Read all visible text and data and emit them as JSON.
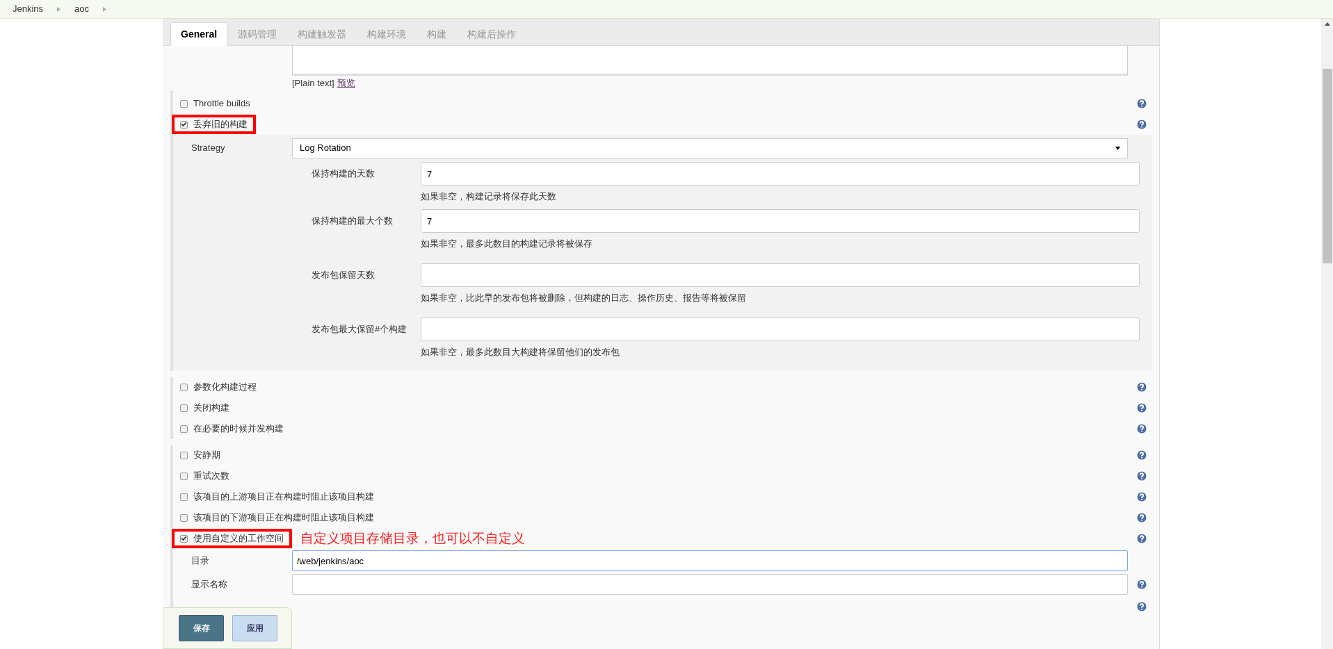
{
  "breadcrumbs": [
    "Jenkins",
    "aoc"
  ],
  "tabs": [
    {
      "label": "General",
      "selected": true
    },
    {
      "label": "源码管理",
      "selected": false
    },
    {
      "label": "构建触发器",
      "selected": false
    },
    {
      "label": "构建环境",
      "selected": false
    },
    {
      "label": "构建",
      "selected": false
    },
    {
      "label": "构建后操作",
      "selected": false
    }
  ],
  "description": {
    "format": "[Plain text]",
    "preview_link": "预览"
  },
  "top_options": [
    {
      "label": "Throttle builds",
      "checked": false,
      "highlighted": false
    },
    {
      "label": "丢弃旧的构建",
      "checked": true,
      "highlighted": true
    }
  ],
  "strategy": {
    "label": "Strategy",
    "value": "Log Rotation",
    "fields": [
      {
        "label": "保持构建的天数",
        "value": "7",
        "hint": "如果非空，构建记录将保存此天数"
      },
      {
        "label": "保持构建的最大个数",
        "value": "7",
        "hint": "如果非空，最多此数目的构建记录将被保存"
      },
      {
        "label": "发布包保留天数",
        "hint": "如果非空，比此早的发布包将被删除，但构建的日志、操作历史、报告等将被保留"
      },
      {
        "label": "发布包最大保留#个构建",
        "hint": "如果非空，最多此数目大构建将保留他们的发布包"
      }
    ]
  },
  "option_groups": [
    [
      {
        "label": "参数化构建过程",
        "checked": false,
        "highlighted": false
      },
      {
        "label": "关闭构建",
        "checked": false,
        "highlighted": false
      },
      {
        "label": "在必要的时候并发构建",
        "checked": false,
        "highlighted": false
      }
    ],
    [
      {
        "label": "安静期",
        "checked": false,
        "highlighted": false
      },
      {
        "label": "重试次数",
        "checked": false,
        "highlighted": false
      },
      {
        "label": "该项目的上游项目正在构建时阻止该项目构建",
        "checked": false,
        "highlighted": false
      },
      {
        "label": "该项目的下游项目正在构建时阻止该项目构建",
        "checked": false,
        "highlighted": false
      },
      {
        "label": "使用自定义的工作空间",
        "checked": true,
        "highlighted": true,
        "annotation": "自定义项目存储目录，也可以不自定义"
      }
    ]
  ],
  "workspace_fields": [
    {
      "label": "目录",
      "value": "/web/jenkins/aoc",
      "focused": true
    },
    {
      "label": "显示名称",
      "focused": false
    }
  ],
  "buttons": [
    {
      "label": "保存",
      "kind": "primary"
    },
    {
      "label": "应用",
      "kind": "secondary"
    }
  ]
}
